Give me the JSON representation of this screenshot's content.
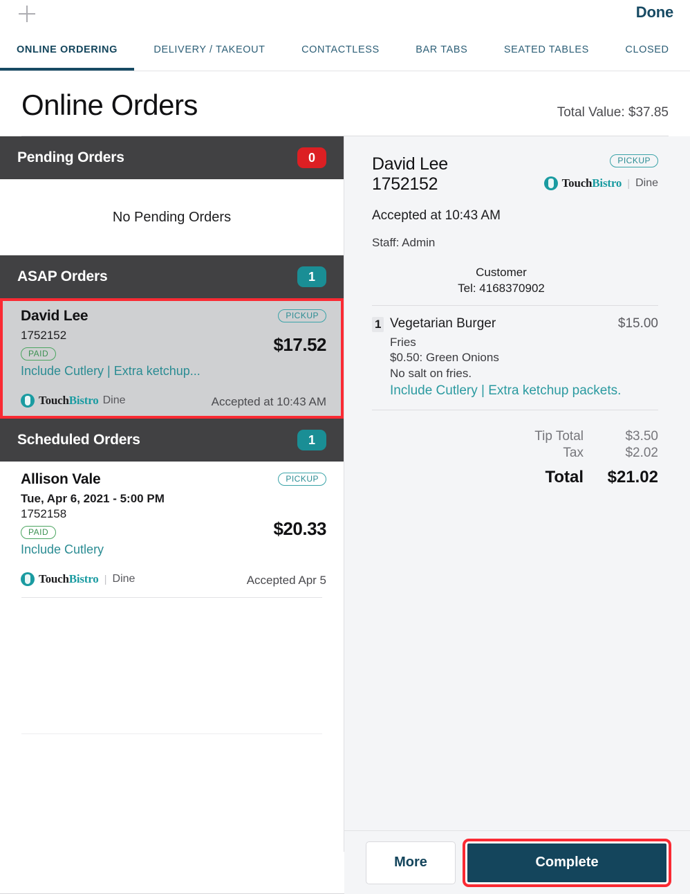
{
  "topbar": {
    "add_icon": "plus-icon",
    "done_label": "Done"
  },
  "tabs": [
    {
      "label": "ONLINE ORDERING",
      "active": true
    },
    {
      "label": "DELIVERY / TAKEOUT",
      "active": false
    },
    {
      "label": "CONTACTLESS",
      "active": false
    },
    {
      "label": "BAR TABS",
      "active": false
    },
    {
      "label": "SEATED TABLES",
      "active": false
    },
    {
      "label": "CLOSED",
      "active": false
    }
  ],
  "header": {
    "title": "Online Orders",
    "total_value": "Total Value: $37.85"
  },
  "sections": {
    "pending": {
      "title": "Pending Orders",
      "count": "0",
      "badge_color": "#dc1f23",
      "empty_message": "No Pending Orders"
    },
    "asap": {
      "title": "ASAP Orders",
      "count": "1",
      "badge_color": "#1a8e95"
    },
    "scheduled": {
      "title": "Scheduled Orders",
      "count": "1",
      "badge_color": "#1a8e95"
    }
  },
  "orders": {
    "asap": [
      {
        "name": "David Lee",
        "order_number": "1752152",
        "type_badge": "PICKUP",
        "payment_badge": "PAID",
        "notes": "Include Cutlery | Extra ketchup...",
        "amount": "$17.52",
        "source_touch": "Touch",
        "source_bistro": "Bistro",
        "source_suffix": "Dine",
        "accepted": "Accepted at 10:43 AM",
        "selected": true
      }
    ],
    "scheduled": [
      {
        "name": "Allison Vale",
        "scheduled_for": "Tue, Apr 6, 2021 - 5:00 PM",
        "order_number": "1752158",
        "type_badge": "PICKUP",
        "payment_badge": "PAID",
        "notes": "Include Cutlery",
        "amount": "$20.33",
        "source_touch": "Touch",
        "source_bistro": "Bistro",
        "source_suffix": "Dine",
        "accepted": "Accepted Apr 5",
        "selected": false
      }
    ]
  },
  "detail": {
    "name": "David Lee",
    "order_number": "1752152",
    "type_badge": "PICKUP",
    "source_touch": "Touch",
    "source_bistro": "Bistro",
    "source_suffix": "Dine",
    "accepted": "Accepted at 10:43 AM",
    "staff": "Staff: Admin",
    "customer_label": "Customer",
    "customer_tel": "Tel: 4168370902",
    "items": [
      {
        "qty": "1",
        "name": "Vegetarian Burger",
        "price": "$15.00",
        "mods": [
          "Fries",
          "$0.50: Green Onions",
          "No salt on fries."
        ],
        "note": "Include Cutlery | Extra ketchup packets."
      }
    ],
    "totals": [
      {
        "label": "Tip Total",
        "value": "$3.50"
      },
      {
        "label": "Tax",
        "value": "$2.02"
      }
    ],
    "grand_total": {
      "label": "Total",
      "value": "$21.02"
    }
  },
  "actions": {
    "more_label": "More",
    "complete_label": "Complete"
  },
  "colors": {
    "accent_teal": "#1a9ba1",
    "dark_navy": "#14455c",
    "section_gray": "#414143",
    "highlight_red": "#fa2a33",
    "badge_red": "#dc1f23",
    "paid_green": "#3d9152"
  }
}
